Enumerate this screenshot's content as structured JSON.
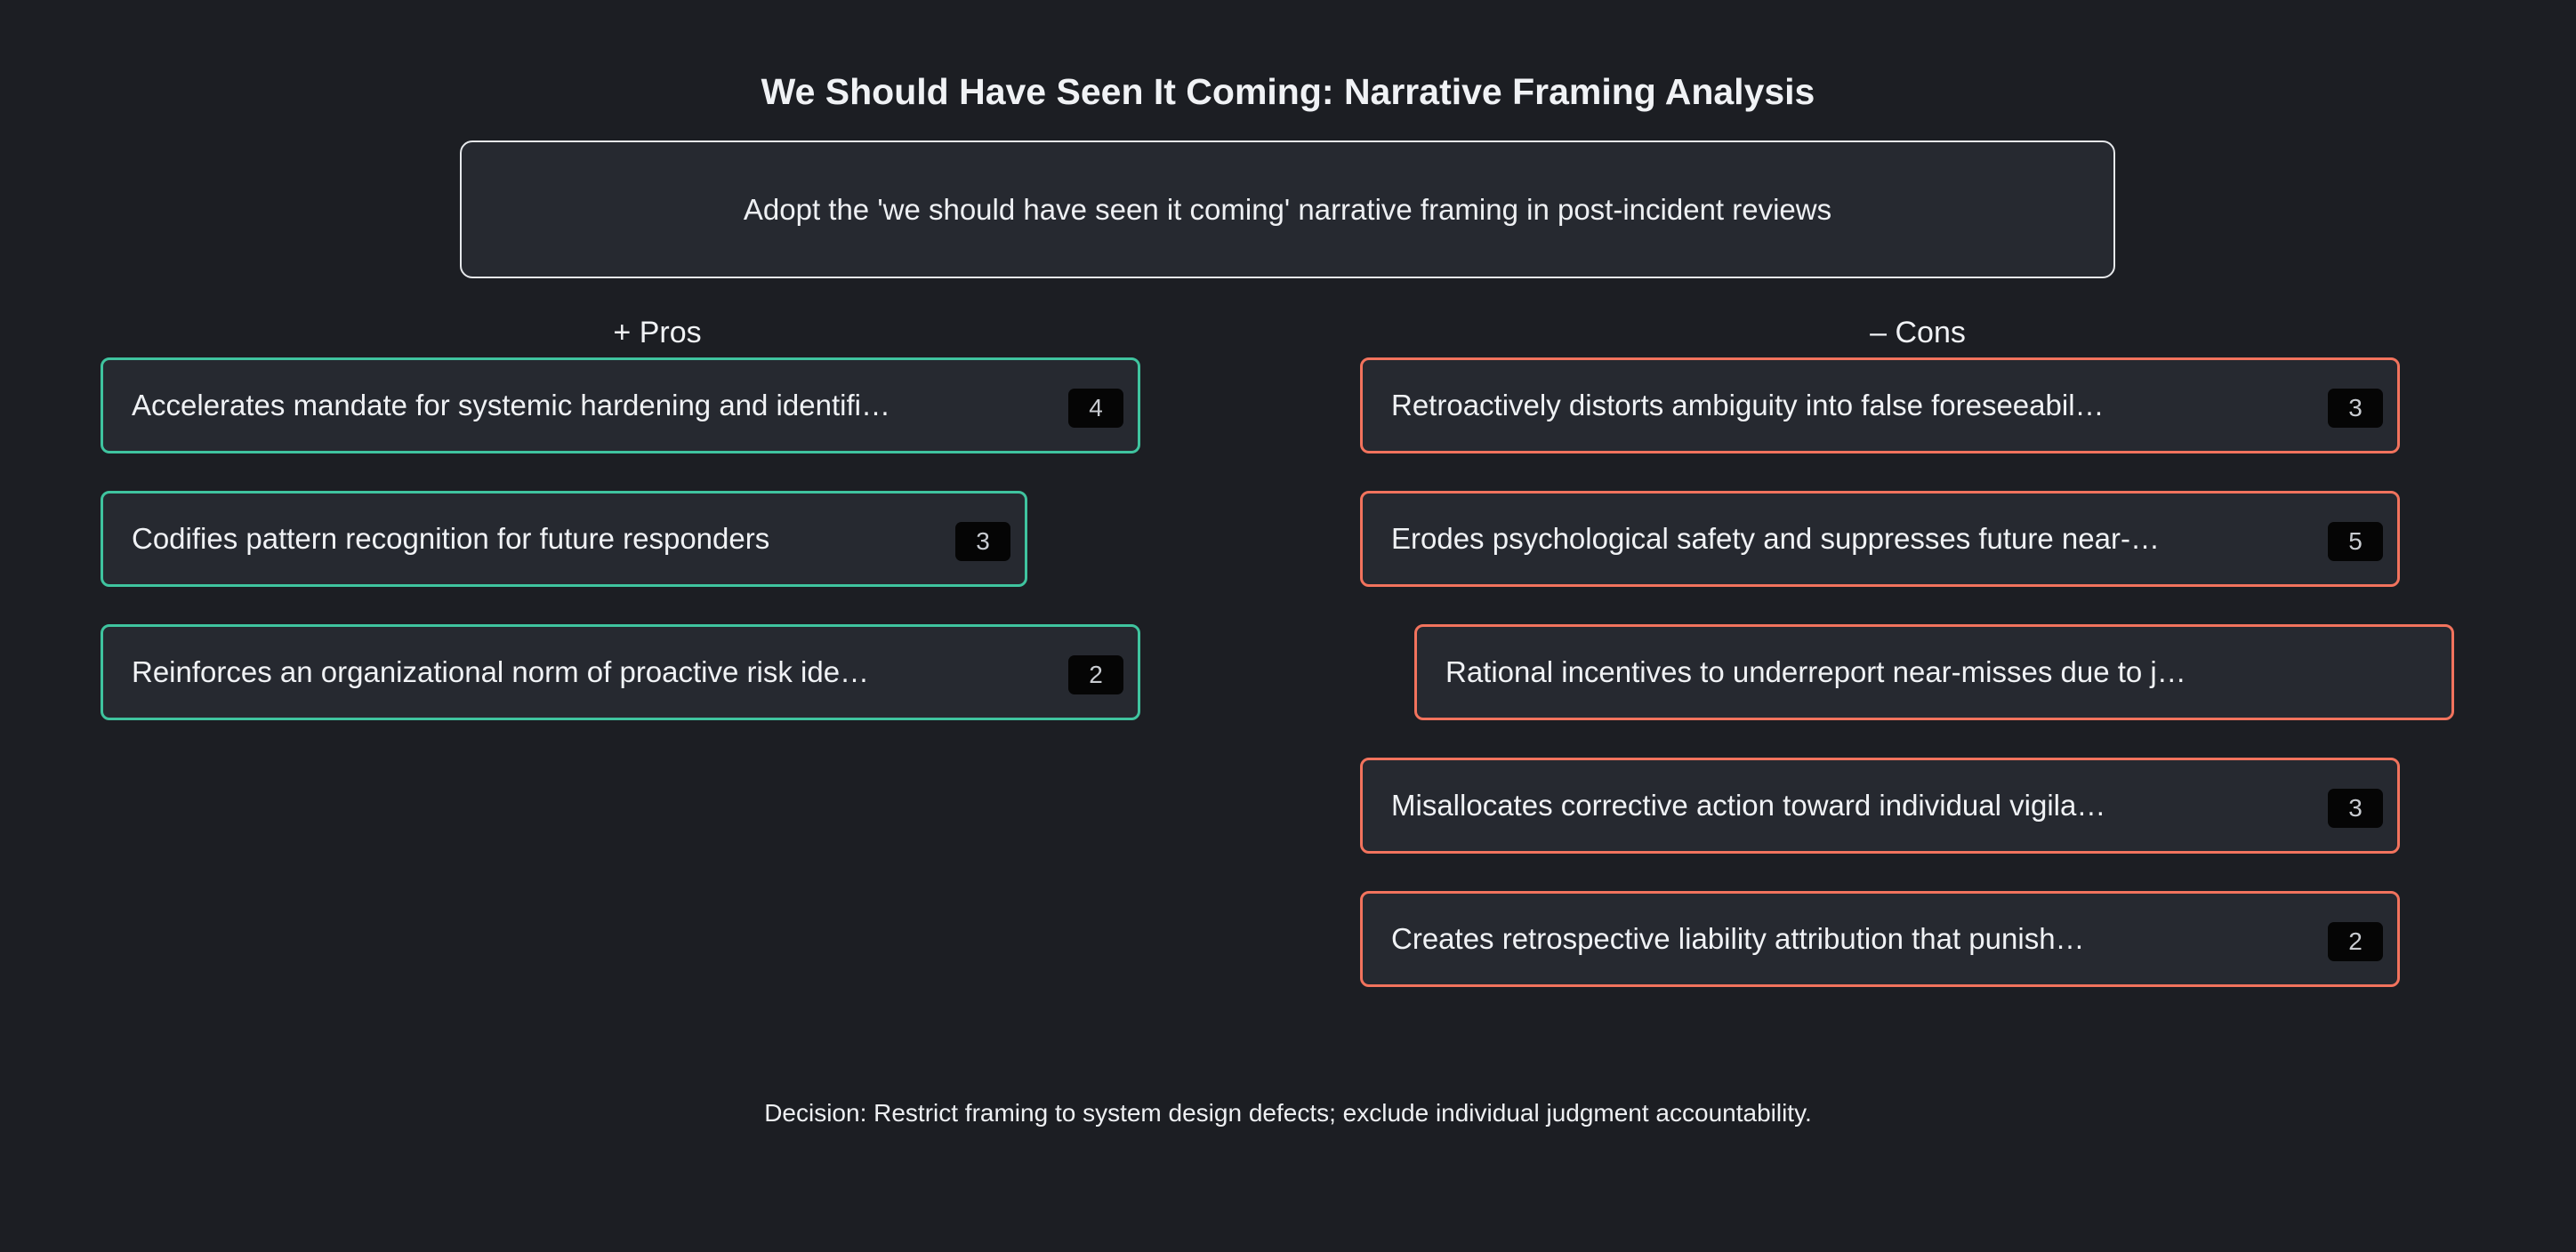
{
  "title": "We Should Have Seen It Coming: Narrative Framing Analysis",
  "proposal": "Adopt the 'we should have seen it coming' narrative framing in post-incident reviews",
  "pros": {
    "heading": "+ Pros",
    "items": [
      {
        "label": "Accelerates mandate for systemic hardening and identifi…",
        "count": "4"
      },
      {
        "label": "Codifies pattern recognition for future responders",
        "count": "3"
      },
      {
        "label": "Reinforces an organizational norm of proactive risk ide…",
        "count": "2"
      }
    ]
  },
  "cons": {
    "heading": "– Cons",
    "items": [
      {
        "label": "Retroactively distorts ambiguity into false foreseeabil…",
        "count": "3"
      },
      {
        "label": "Erodes psychological safety and suppresses future near-…",
        "count": "5"
      },
      {
        "label": "Rational incentives to underreport near-misses due to j…"
      },
      {
        "label": "Misallocates corrective action toward individual vigila…",
        "count": "3"
      },
      {
        "label": "Creates retrospective liability attribution that punish…",
        "count": "2"
      }
    ]
  },
  "decision": "Decision: Restrict framing to system design defects; exclude individual judgment accountability.",
  "colors": {
    "background": "#1c1e23",
    "card_background": "#262930",
    "pro_border": "#3fc49f",
    "con_border": "#f2735d",
    "proposal_border": "#e6e8eb"
  }
}
